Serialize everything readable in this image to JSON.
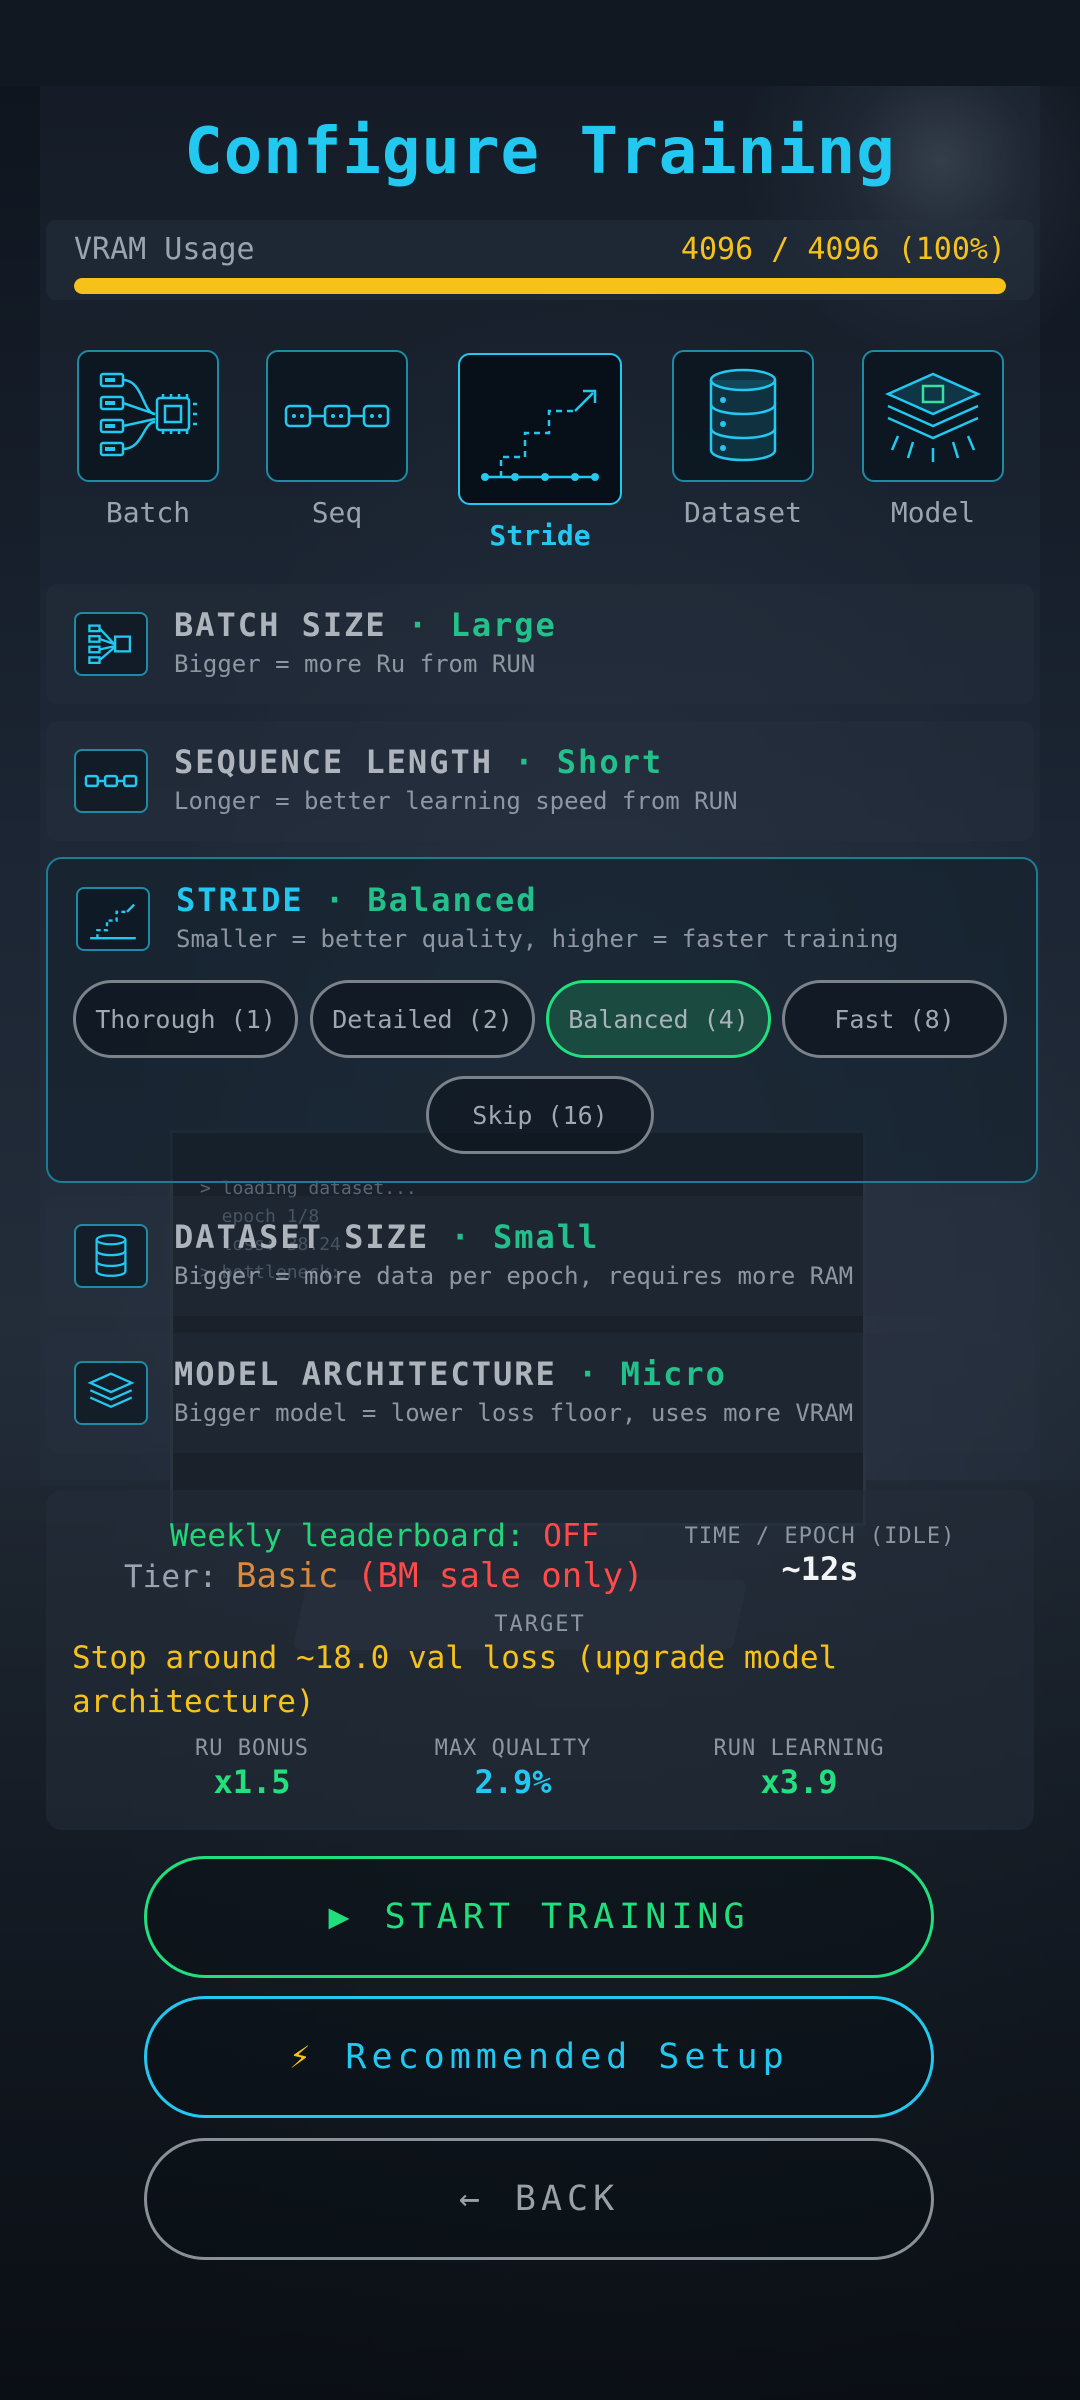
{
  "header": {
    "title": "Configure Training"
  },
  "vram": {
    "label": "VRAM Usage",
    "value": "4096 / 4096 (100%)",
    "percent": 100
  },
  "tabs": [
    {
      "label": "Batch",
      "icon": "batch-chip-icon"
    },
    {
      "label": "Seq",
      "icon": "sequence-chain-icon"
    },
    {
      "label": "Stride",
      "icon": "stride-steps-icon",
      "selected": true
    },
    {
      "label": "Dataset",
      "icon": "database-icon"
    },
    {
      "label": "Model",
      "icon": "layers-chip-icon"
    }
  ],
  "settings": {
    "batch": {
      "title": "BATCH SIZE",
      "sep": "·",
      "value": "Large",
      "desc": "Bigger = more Ru from RUN"
    },
    "sequence": {
      "title": "SEQUENCE LENGTH",
      "sep": "·",
      "value": "Short",
      "desc": "Longer = better learning speed from RUN"
    },
    "stride": {
      "title": "STRIDE",
      "sep": "·",
      "value": "Balanced",
      "desc": "Smaller = better quality, higher = faster training",
      "options": [
        "Thorough (1)",
        "Detailed (2)",
        "Balanced (4)",
        "Fast (8)",
        "Skip (16)"
      ],
      "selected": "Balanced (4)"
    },
    "dataset": {
      "title": "DATASET SIZE",
      "sep": "·",
      "value": "Small",
      "desc": "Bigger = more data per epoch, requires more RAM"
    },
    "model": {
      "title": "MODEL ARCHITECTURE",
      "sep": "·",
      "value": "Micro",
      "desc": "Bigger model = lower loss floor, uses more VRAM"
    }
  },
  "summary": {
    "leaderboard_label": "Weekly leaderboard:",
    "leaderboard_value": "OFF",
    "tier_label": "Tier:",
    "tier_value": "Basic",
    "tier_note": "(BM sale only)",
    "epoch_label": "TIME / EPOCH (IDLE)",
    "epoch_value": "~12s",
    "target_label": "TARGET",
    "target_text": "Stop around ~18.0 val loss (upgrade model architecture)",
    "stats": [
      {
        "label": "RU BONUS",
        "value": "x1.5",
        "color": "#22e07d"
      },
      {
        "label": "MAX QUALITY",
        "value": "2.9%",
        "color": "#22c8f0"
      },
      {
        "label": "RUN LEARNING",
        "value": "x3.9",
        "color": "#22e07d"
      }
    ]
  },
  "buttons": {
    "start": {
      "glyph": "▶",
      "label": "START TRAINING"
    },
    "recommended": {
      "glyph": "⚡",
      "label": "Recommended Setup"
    },
    "back": {
      "glyph": "←",
      "label": "BACK"
    }
  },
  "background": {
    "terminal_lines": [
      "> loading dataset...",
      "  epoch 1/8",
      "  loss: 38.24",
      "> bottleneck:"
    ]
  },
  "colors": {
    "accent": "#22c8f0",
    "green": "#1fe07d",
    "yellow": "#f6c21a",
    "red": "#ff4a4a",
    "orange": "#d98a3b"
  }
}
